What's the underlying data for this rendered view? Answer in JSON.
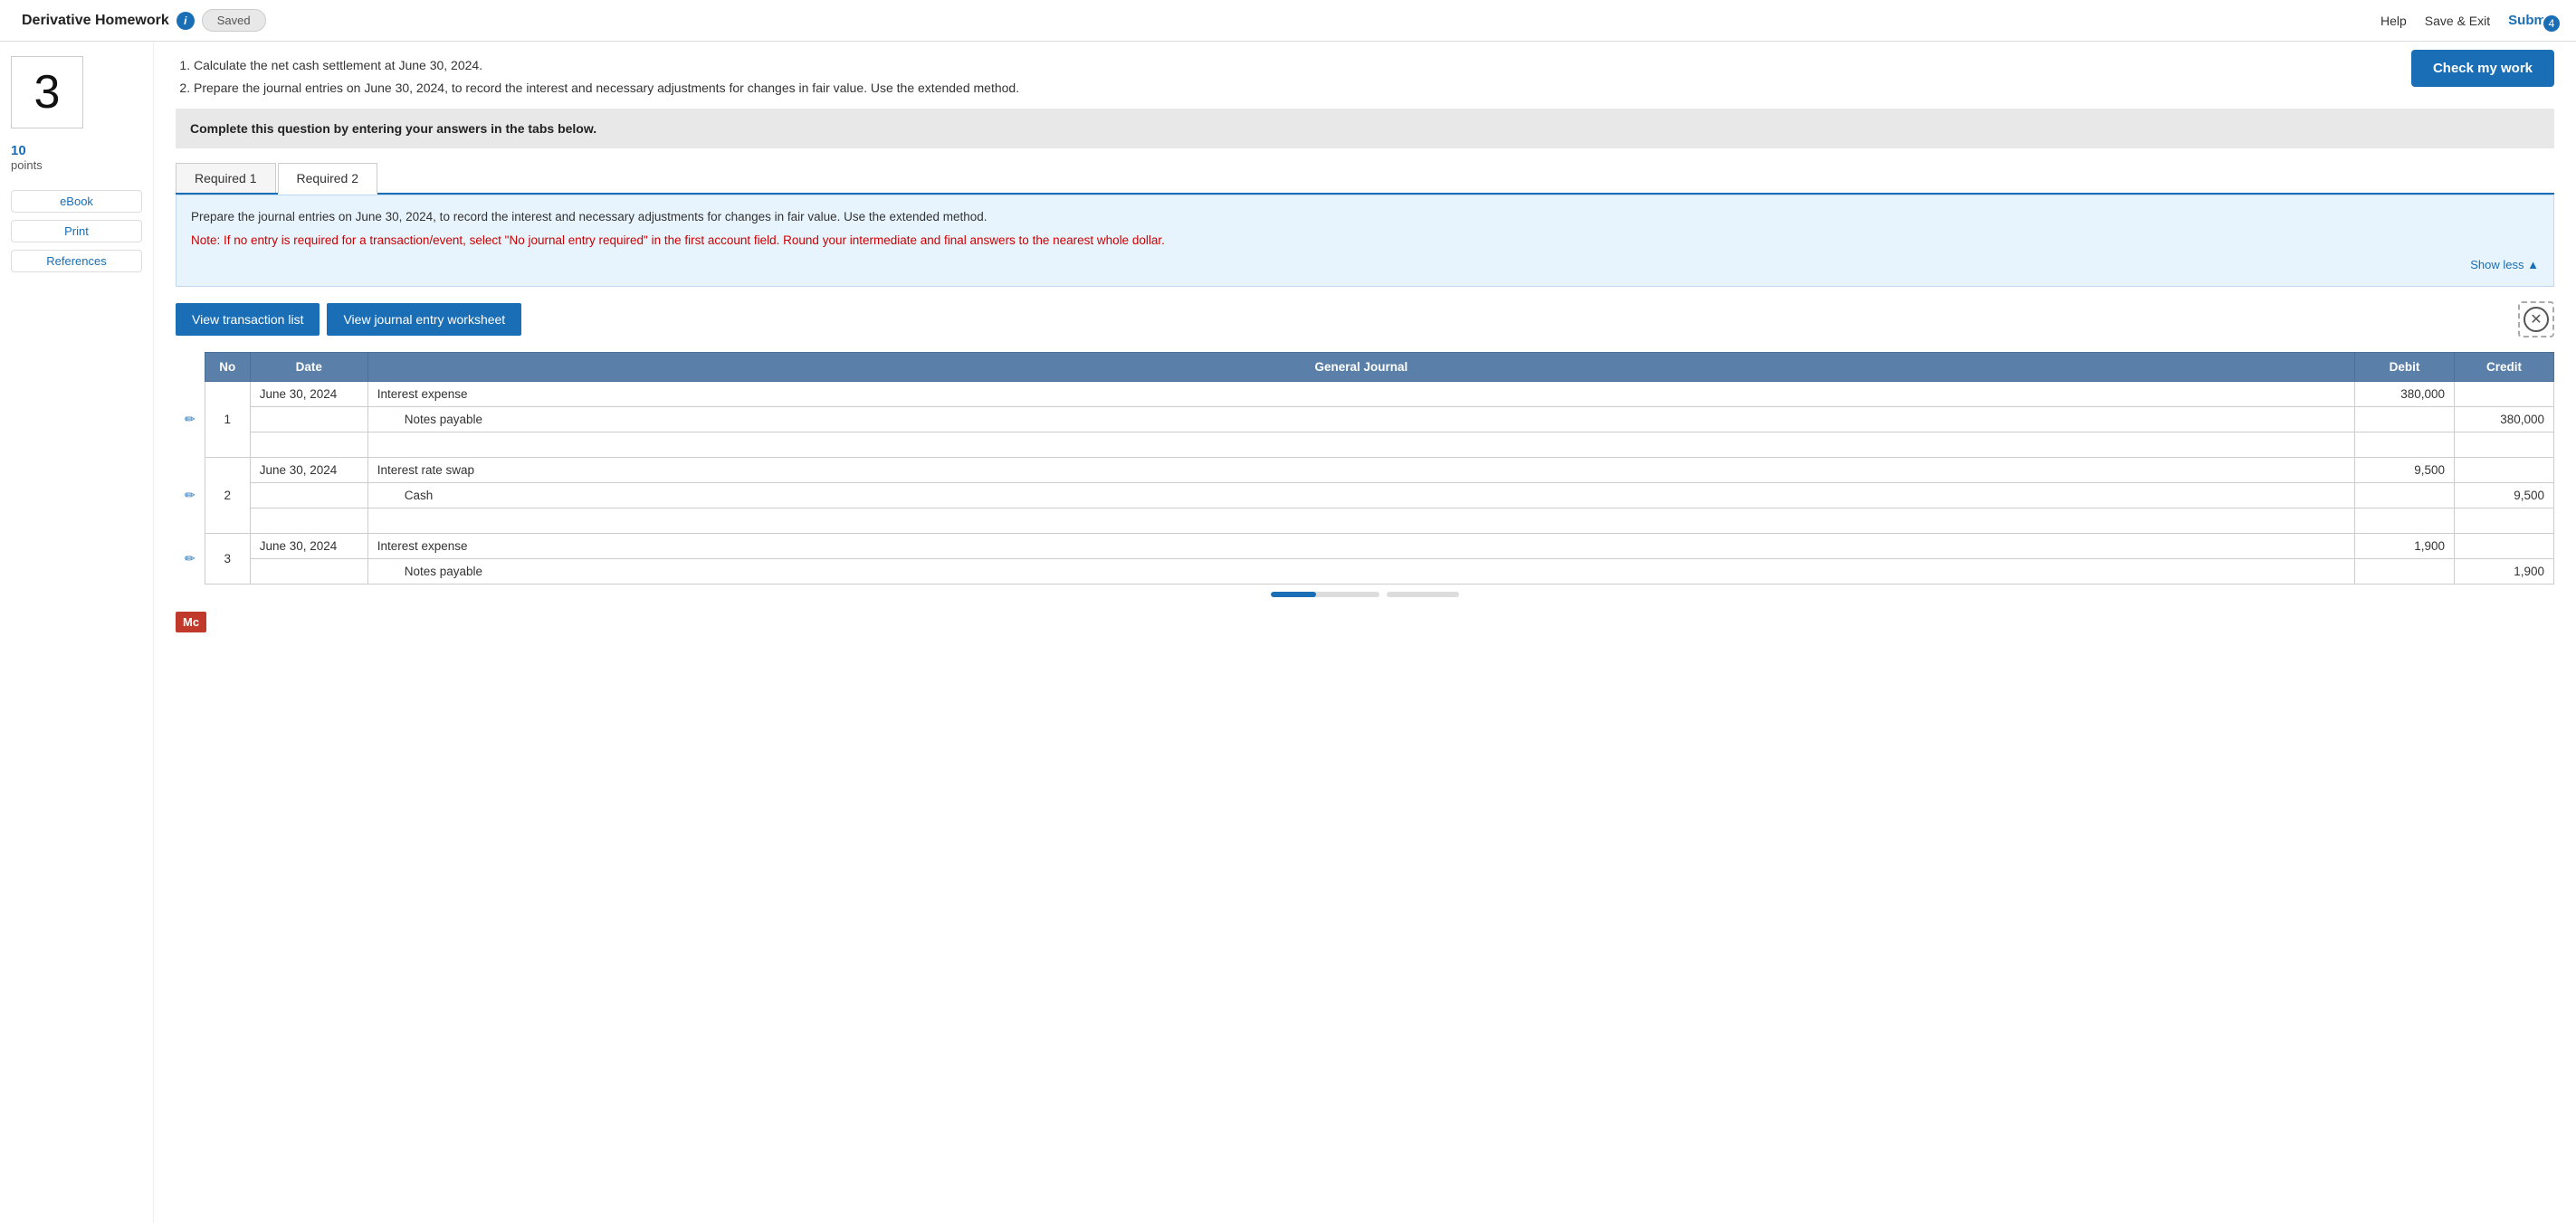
{
  "header": {
    "title": "Derivative Homework",
    "saved_label": "Saved",
    "help_label": "Help",
    "save_exit_label": "Save & Exit",
    "submit_label": "Submit"
  },
  "check_work": {
    "button_label": "Check my work",
    "badge_count": "4"
  },
  "sidebar": {
    "question_number": "3",
    "points_value": "10",
    "points_label": "points",
    "ebook_label": "eBook",
    "print_label": "Print",
    "references_label": "References"
  },
  "question": {
    "items": [
      "Calculate the net cash settlement at June 30, 2024.",
      "Prepare the journal entries on June 30, 2024, to record the interest and necessary adjustments for changes in fair value. Use the extended method."
    ]
  },
  "instruction": {
    "text": "Complete this question by entering your answers in the tabs below."
  },
  "tabs": [
    {
      "label": "Required 1",
      "active": false
    },
    {
      "label": "Required 2",
      "active": true
    }
  ],
  "info_panel": {
    "text": "Prepare the journal entries on June 30, 2024, to record the interest and necessary adjustments for changes in fair value. Use the extended method.",
    "note": "Note: If no entry is required for a transaction/event, select \"No journal entry required\" in the first account field. Round your intermediate and final answers to the nearest whole dollar.",
    "show_less_label": "Show less"
  },
  "buttons": {
    "view_transaction_list": "View transaction list",
    "view_journal_entry_worksheet": "View journal entry worksheet"
  },
  "table": {
    "headers": [
      "No",
      "Date",
      "General Journal",
      "Debit",
      "Credit"
    ],
    "rows": [
      {
        "entry_no": "1",
        "edit": true,
        "lines": [
          {
            "date": "June 30, 2024",
            "account": "Interest expense",
            "debit": "380,000",
            "credit": ""
          },
          {
            "date": "",
            "account": "Notes payable",
            "debit": "",
            "credit": "380,000",
            "indent": true
          },
          {
            "date": "",
            "account": "",
            "debit": "",
            "credit": "",
            "empty": true
          }
        ]
      },
      {
        "entry_no": "2",
        "edit": true,
        "lines": [
          {
            "date": "June 30, 2024",
            "account": "Interest rate swap",
            "debit": "9,500",
            "credit": ""
          },
          {
            "date": "",
            "account": "Cash",
            "debit": "",
            "credit": "9,500",
            "indent": true
          },
          {
            "date": "",
            "account": "",
            "debit": "",
            "credit": "",
            "empty": true
          }
        ]
      },
      {
        "entry_no": "3",
        "edit": true,
        "lines": [
          {
            "date": "June 30, 2024",
            "account": "Interest expense",
            "debit": "1,900",
            "credit": ""
          },
          {
            "date": "",
            "account": "Notes payable",
            "debit": "",
            "credit": "1,900",
            "indent": true
          }
        ]
      }
    ]
  },
  "mc_badge": "Mc"
}
